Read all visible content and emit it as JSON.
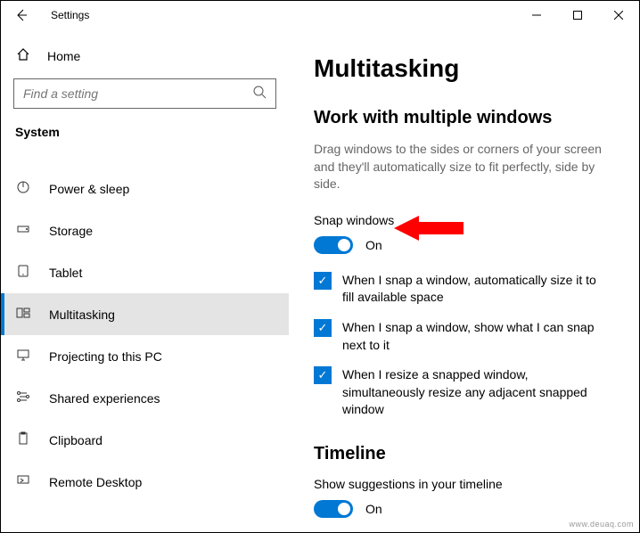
{
  "titlebar": {
    "app_name": "Settings"
  },
  "sidebar": {
    "home": "Home",
    "search_placeholder": "Find a setting",
    "section": "System",
    "items": [
      {
        "icon": "power",
        "label": "Power & sleep"
      },
      {
        "icon": "storage",
        "label": "Storage"
      },
      {
        "icon": "tablet",
        "label": "Tablet"
      },
      {
        "icon": "multitask",
        "label": "Multitasking"
      },
      {
        "icon": "project",
        "label": "Projecting to this PC"
      },
      {
        "icon": "shared",
        "label": "Shared experiences"
      },
      {
        "icon": "clipboard",
        "label": "Clipboard"
      },
      {
        "icon": "remote",
        "label": "Remote Desktop"
      }
    ]
  },
  "main": {
    "title": "Multitasking",
    "section1": {
      "heading": "Work with multiple windows",
      "desc": "Drag windows to the sides or corners of your screen and they'll automatically size to fit perfectly, side by side.",
      "snap_label": "Snap windows",
      "snap_state": "On",
      "checks": [
        "When I snap a window, automatically size it to fill available space",
        "When I snap a window, show what I can snap next to it",
        "When I resize a snapped window, simultaneously resize any adjacent snapped window"
      ]
    },
    "section2": {
      "heading": "Timeline",
      "suggestions_label": "Show suggestions in your timeline",
      "suggestions_state": "On"
    }
  },
  "watermark": "www.deuaq.com"
}
